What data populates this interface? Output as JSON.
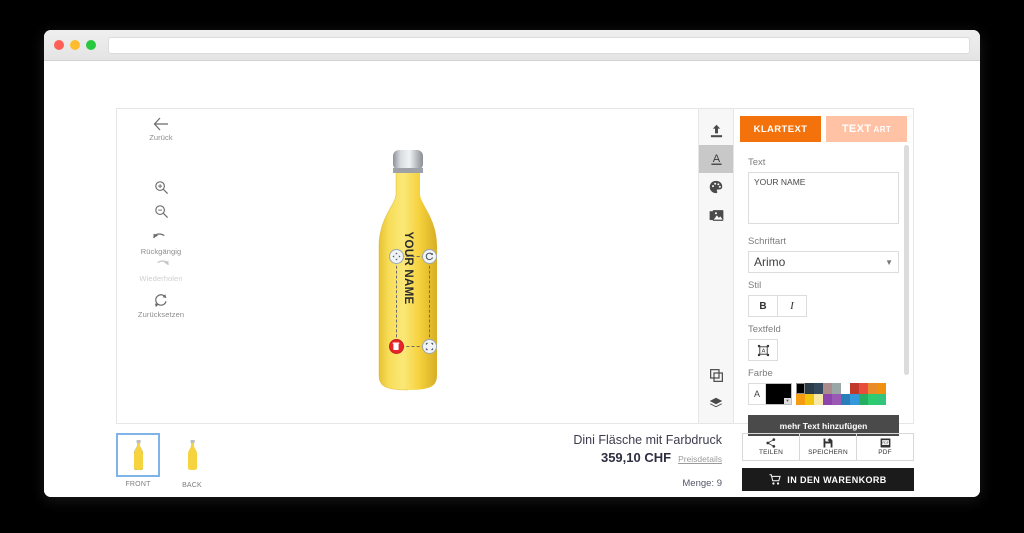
{
  "window": {
    "url_value": "",
    "url_placeholder": ""
  },
  "canvas_tools": [
    {
      "name": "back",
      "icon": "arrow-left-icon",
      "label": "Zurück",
      "disabled": false
    },
    {
      "name": "zoom-in",
      "icon": "zoom-in-icon",
      "label": "",
      "disabled": false
    },
    {
      "name": "zoom-out",
      "icon": "zoom-out-icon",
      "label": "",
      "disabled": false
    },
    {
      "name": "undo",
      "icon": "undo-icon",
      "label": "Rückgängig",
      "disabled": false
    },
    {
      "name": "redo",
      "icon": "redo-icon",
      "label": "Wiederholen",
      "disabled": true
    },
    {
      "name": "reset",
      "icon": "reset-icon",
      "label": "Zurücksetzen",
      "disabled": false
    }
  ],
  "product_preview": {
    "label_text": "YOUR NAME",
    "bottle_color": "#f5d242",
    "cap_color": "#b9bcc0",
    "handles": [
      {
        "name": "move-handle",
        "icon": "move-icon"
      },
      {
        "name": "rotate-handle",
        "icon": "rotate-icon"
      },
      {
        "name": "delete-handle",
        "icon": "trash-icon"
      },
      {
        "name": "resize-handle",
        "icon": "resize-icon"
      }
    ]
  },
  "rail": {
    "top_items": [
      {
        "name": "upload",
        "icon": "upload-icon",
        "active": false
      },
      {
        "name": "text",
        "icon": "text-a-icon",
        "active": true
      },
      {
        "name": "color",
        "icon": "palette-icon",
        "active": false
      },
      {
        "name": "gallery",
        "icon": "images-icon",
        "active": false
      }
    ],
    "bottom_items": [
      {
        "name": "duplicate",
        "icon": "copy-icon"
      },
      {
        "name": "layers",
        "icon": "layers-icon"
      }
    ]
  },
  "panel": {
    "tabs": [
      {
        "name": "plain-text",
        "label": "KLARTEXT",
        "active": true,
        "color": "#f4720b"
      },
      {
        "name": "text-art",
        "label_main": "TEXT",
        "label_sub": "ART",
        "active": false,
        "color": "#ffc2a4"
      }
    ],
    "text": {
      "label": "Text",
      "value": "YOUR NAME",
      "placeholder": ""
    },
    "font": {
      "label": "Schriftart",
      "value": "Arimo",
      "chevron": "chevron-down-icon"
    },
    "style": {
      "label": "Stil",
      "bold": "B",
      "italic": "I"
    },
    "textfield": {
      "label": "Textfeld",
      "icon": "text-box-icon"
    },
    "color": {
      "label": "Farbe",
      "a_glyph": "A",
      "current": "#000000",
      "swatches_row1": [
        "#000000",
        "#2b3b47",
        "#35495e",
        "#ab8b8b",
        "#9aa7a7",
        "#ffffff",
        "#c0392b",
        "#e74c3c",
        "#e98b2a",
        "#f09010"
      ],
      "swatches_row2": [
        "#f39c12",
        "#f1c40f",
        "#f7e8a8",
        "#8e44ad",
        "#9b59b6",
        "#2980b9",
        "#3498db",
        "#27ae60",
        "#2ecc71",
        "#34c47c"
      ],
      "selected_index": 0
    },
    "add_text_button": "mehr Text hinzufügen"
  },
  "views": [
    {
      "name": "front",
      "label": "FRONT",
      "selected": true
    },
    {
      "name": "back",
      "label": "BACK",
      "selected": false
    }
  ],
  "product": {
    "name": "Dini Fläsche mit Farbdruck",
    "price": "359,10 CHF",
    "price_details_link": "Preisdetails",
    "quantity": "Menge: 9"
  },
  "actions": [
    {
      "name": "share",
      "icon": "share-icon",
      "label": "TEILEN"
    },
    {
      "name": "save",
      "icon": "save-icon",
      "label": "SPEICHERN"
    },
    {
      "name": "pdf",
      "icon": "pdf-icon",
      "label": "PDF"
    }
  ],
  "cart_button": {
    "icon": "cart-icon",
    "label": "IN DEN WARENKORB"
  }
}
